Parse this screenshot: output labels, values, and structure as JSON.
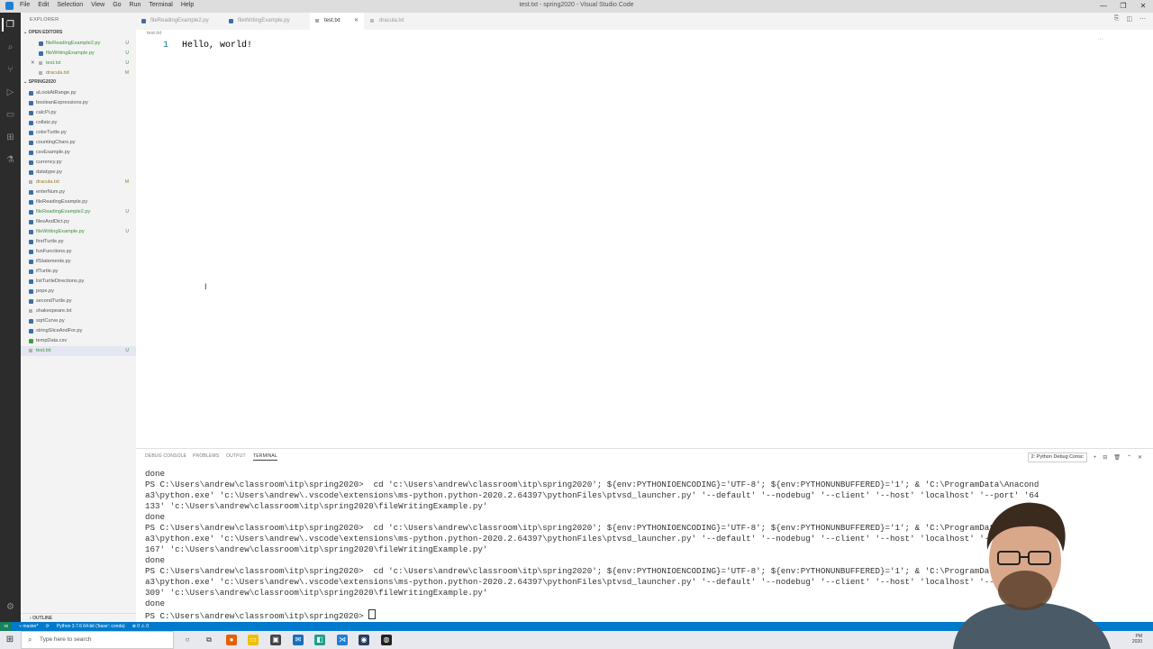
{
  "window": {
    "title": "test.txt - spring2020 - Visual Studio Code",
    "menu": [
      "File",
      "Edit",
      "Selection",
      "View",
      "Go",
      "Run",
      "Terminal",
      "Help"
    ],
    "controls": [
      "—",
      "❐",
      "✕"
    ]
  },
  "sidebar": {
    "header": "EXPLORER",
    "open_editors_title": "OPEN EDITORS",
    "open_editors": [
      {
        "name": "fileReadingExample2.py",
        "badge": "U",
        "kind": "py",
        "status": "u"
      },
      {
        "name": "fileWritingExample.py",
        "badge": "U",
        "kind": "py",
        "status": "u"
      },
      {
        "name": "test.txt",
        "badge": "U",
        "kind": "txt",
        "status": "u",
        "close": "✕"
      },
      {
        "name": "dracula.txt",
        "badge": "M",
        "kind": "txt",
        "status": "m"
      }
    ],
    "folder_title": "SPRING2020",
    "files": [
      {
        "name": "aLookAtRange.py",
        "badge": "",
        "kind": "py",
        "status": "plain"
      },
      {
        "name": "booleanExpressions.py",
        "badge": "",
        "kind": "py",
        "status": "plain"
      },
      {
        "name": "calcPi.py",
        "badge": "",
        "kind": "py",
        "status": "plain"
      },
      {
        "name": "collatz.py",
        "badge": "",
        "kind": "py",
        "status": "plain"
      },
      {
        "name": "colorTurtle.py",
        "badge": "",
        "kind": "py",
        "status": "plain"
      },
      {
        "name": "countingChars.py",
        "badge": "",
        "kind": "py",
        "status": "plain"
      },
      {
        "name": "csvExample.py",
        "badge": "",
        "kind": "py",
        "status": "plain"
      },
      {
        "name": "currency.py",
        "badge": "",
        "kind": "py",
        "status": "plain"
      },
      {
        "name": "datatype.py",
        "badge": "",
        "kind": "py",
        "status": "plain"
      },
      {
        "name": "dracula.txt",
        "badge": "M",
        "kind": "txt",
        "status": "m"
      },
      {
        "name": "enterNum.py",
        "badge": "",
        "kind": "py",
        "status": "plain"
      },
      {
        "name": "fileReadingExample.py",
        "badge": "",
        "kind": "py",
        "status": "plain"
      },
      {
        "name": "fileReadingExample2.py",
        "badge": "U",
        "kind": "py",
        "status": "u"
      },
      {
        "name": "filesAndDict.py",
        "badge": "",
        "kind": "py",
        "status": "plain"
      },
      {
        "name": "fileWritingExample.py",
        "badge": "U",
        "kind": "py",
        "status": "u"
      },
      {
        "name": "firstTurtle.py",
        "badge": "",
        "kind": "py",
        "status": "plain"
      },
      {
        "name": "funFunctions.py",
        "badge": "",
        "kind": "py",
        "status": "plain"
      },
      {
        "name": "ifStatements.py",
        "badge": "",
        "kind": "py",
        "status": "plain"
      },
      {
        "name": "ifTurtle.py",
        "badge": "",
        "kind": "py",
        "status": "plain"
      },
      {
        "name": "listTurtleDirections.py",
        "badge": "",
        "kind": "py",
        "status": "plain"
      },
      {
        "name": "pope.py",
        "badge": "",
        "kind": "py",
        "status": "plain"
      },
      {
        "name": "secondTurtle.py",
        "badge": "",
        "kind": "py",
        "status": "plain"
      },
      {
        "name": "shakespeare.txt",
        "badge": "",
        "kind": "txt",
        "status": "plain"
      },
      {
        "name": "sqrtCurve.py",
        "badge": "",
        "kind": "py",
        "status": "plain"
      },
      {
        "name": "stringSliceAndFor.py",
        "badge": "",
        "kind": "py",
        "status": "plain"
      },
      {
        "name": "tempData.csv",
        "badge": "",
        "kind": "csv",
        "status": "plain"
      },
      {
        "name": "test.txt",
        "badge": "U",
        "kind": "txt",
        "status": "u",
        "selected": true
      }
    ],
    "outline_title": "OUTLINE"
  },
  "tabs": [
    {
      "label": "fileReadingExample2.py",
      "kind": "py",
      "active": false
    },
    {
      "label": "fileWritingExample.py",
      "kind": "py",
      "active": false
    },
    {
      "label": "test.txt",
      "kind": "txt",
      "active": true,
      "close": "✕"
    },
    {
      "label": "dracula.txt",
      "kind": "txt",
      "active": false
    }
  ],
  "breadcrumb": "test.txt",
  "editor": {
    "line_number": "1",
    "line_text": "Hello, world!",
    "more": "···"
  },
  "panel": {
    "tabs": [
      "DEBUG CONSOLE",
      "PROBLEMS",
      "OUTPUT",
      "TERMINAL"
    ],
    "active_tab": "TERMINAL",
    "terminal_select": "2: Python Debug Consc",
    "actions": [
      "+",
      "⊟",
      "🗑",
      "⌃",
      "✕"
    ],
    "terminal_lines": [
      "done",
      "PS C:\\Users\\andrew\\classroom\\itp\\spring2020>  cd 'c:\\Users\\andrew\\classroom\\itp\\spring2020'; ${env:PYTHONIOENCODING}='UTF-8'; ${env:PYTHONUNBUFFERED}='1'; & 'C:\\ProgramData\\Anacond",
      "a3\\python.exe' 'c:\\Users\\andrew\\.vscode\\extensions\\ms-python.python-2020.2.64397\\pythonFiles\\ptvsd_launcher.py' '--default' '--nodebug' '--client' '--host' 'localhost' '--port' '64",
      "133' 'c:\\Users\\andrew\\classroom\\itp\\spring2020\\fileWritingExample.py'",
      "done",
      "PS C:\\Users\\andrew\\classroom\\itp\\spring2020>  cd 'c:\\Users\\andrew\\classroom\\itp\\spring2020'; ${env:PYTHONIOENCODING}='UTF-8'; ${env:PYTHONUNBUFFERED}='1'; & 'C:\\ProgramData\\Anacond",
      "a3\\python.exe' 'c:\\Users\\andrew\\.vscode\\extensions\\ms-python.python-2020.2.64397\\pythonFiles\\ptvsd_launcher.py' '--default' '--nodebug' '--client' '--host' 'localhost' '--port' '64",
      "167' 'c:\\Users\\andrew\\classroom\\itp\\spring2020\\fileWritingExample.py'",
      "done",
      "PS C:\\Users\\andrew\\classroom\\itp\\spring2020>  cd 'c:\\Users\\andrew\\classroom\\itp\\spring2020'; ${env:PYTHONIOENCODING}='UTF-8'; ${env:PYTHONUNBUFFERED}='1'; & 'C:\\ProgramData\\Anacond",
      "a3\\python.exe' 'c:\\Users\\andrew\\.vscode\\extensions\\ms-python.python-2020.2.64397\\pythonFiles\\ptvsd_launcher.py' '--default' '--nodebug' '--client' '--host' 'localhost' '--port' '64",
      "309' 'c:\\Users\\andrew\\classroom\\itp\\spring2020\\fileWritingExample.py'",
      "done",
      "PS C:\\Users\\andrew\\classroom\\itp\\spring2020> "
    ]
  },
  "statusbar": {
    "branch": "master*",
    "sync": "⟳",
    "interpreter": "Python 3.7.6 64-bit ('base': conda)",
    "problems": "⊗ 0  ⚠ 0"
  },
  "taskbar": {
    "search_placeholder": "Type here to search",
    "time": "PM",
    "date": "2020"
  },
  "colors": {
    "accent": "#007acc",
    "activity_bar": "#2c2c2c",
    "sidebar": "#f3f3f3"
  }
}
